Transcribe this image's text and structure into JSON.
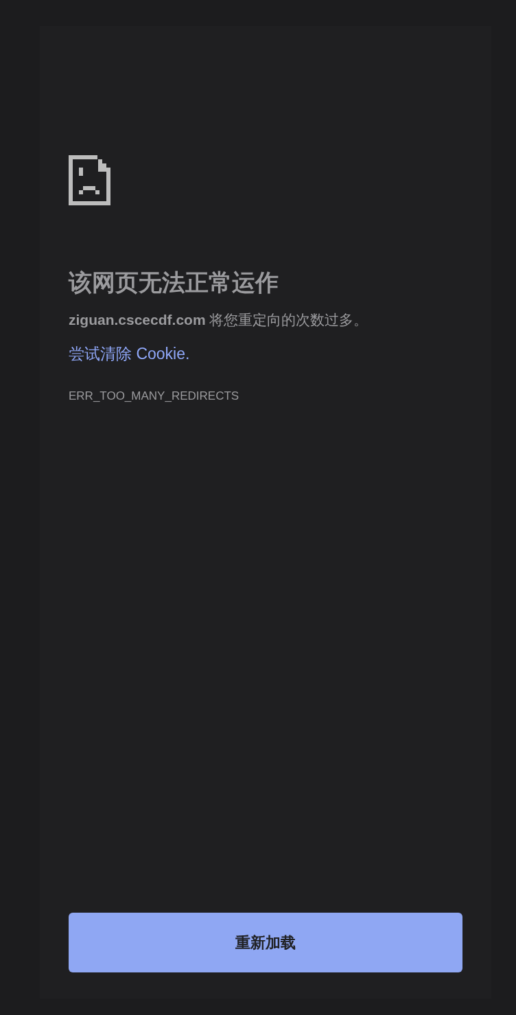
{
  "error_page": {
    "title": "该网页无法正常运作",
    "description": "**ziguan.cscecdf.com** 将您重定向的次数过多。",
    "suggestion_link": "尝试清除 Cookie.",
    "error_code": "ERR_TOO_MANY_REDIRECTS",
    "reload_button": "重新加载"
  }
}
